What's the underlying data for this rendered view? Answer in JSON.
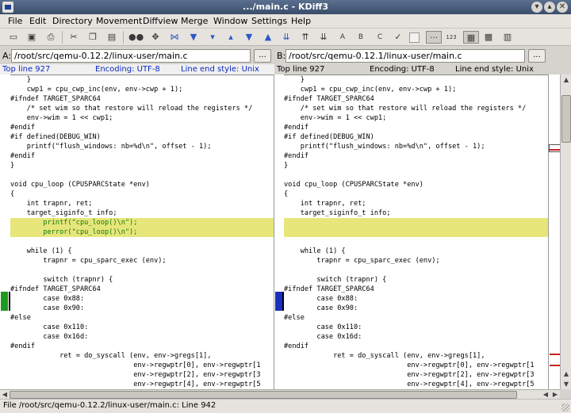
{
  "window": {
    "title": ".../main.c - KDiff3"
  },
  "menubar": [
    "File",
    "Edit",
    "Directory",
    "Movement",
    "Diffview",
    "Merge",
    "Window",
    "Settings",
    "Help"
  ],
  "toolbar": {
    "icons": [
      "open-icon",
      "save-icon",
      "print-icon",
      "cut-icon",
      "copy-icon",
      "paste-icon",
      "find-icon",
      "go-current-icon",
      "go-top-icon",
      "go-bottom-icon",
      "go-prev-delta-icon",
      "go-next-delta-icon",
      "go-prev-conflict-icon",
      "go-next-conflict-icon",
      "go-prev-unsolved-icon",
      "go-next-unsolved-icon",
      "choose-a-icon",
      "choose-b-icon",
      "choose-c-icon",
      "auto-advance-icon",
      "show-whitespace-icon",
      "show-line-numbers-icon",
      "split-diff-icon",
      "join-diffs-icon",
      "toggle-overview-icon"
    ],
    "text_buttons": {
      "choose_a": "A",
      "choose_b": "B",
      "choose_c": "C",
      "line_numbers": "123"
    }
  },
  "paneA": {
    "label": "A:",
    "path": "/root/src/qemu-0.12.2/linux-user/main.c",
    "browse": "...",
    "top_line": "Top line 927",
    "encoding": "Encoding: UTF-8",
    "line_end": "Line end style: Unix",
    "lines": [
      "    }",
      "    cwp1 = cpu_cwp_inc(env, env->cwp + 1);",
      "#ifndef TARGET_SPARC64",
      "    /* set wim so that restore will reload the registers */",
      "    env->wim = 1 << cwp1;",
      "#endif",
      "#if defined(DEBUG_WIN)",
      "    printf(\"flush_windows: nb=%d\\n\", offset - 1);",
      "#endif",
      "}",
      "",
      "void cpu_loop (CPUSPARCState *env)",
      "{",
      "    int trapnr, ret;",
      "    target_siginfo_t info;",
      "        printf(\"cpu_loop()\\n\");",
      "        perror(\"cpu_loop()\\n\");",
      "",
      "    while (1) {",
      "        trapnr = cpu_sparc_exec (env);",
      "",
      "        switch (trapnr) {",
      "#ifndef TARGET_SPARC64",
      "        case 0x88:",
      "        case 0x90:",
      "#else",
      "        case 0x110:",
      "        case 0x16d:",
      "#endif",
      "            ret = do_syscall (env, env->gregs[1],",
      "                              env->regwptr[0], env->regwptr[1",
      "                              env->regwptr[2], env->regwptr[3",
      "                              env->regwptr[4], env->regwptr[5"
    ]
  },
  "paneB": {
    "label": "B:",
    "path": "/root/src/qemu-0.12.1/linux-user/main.c",
    "browse": "...",
    "top_line": "Top line 927",
    "encoding": "Encoding: UTF-8",
    "line_end": "Line end style: Unix",
    "lines": [
      "    }",
      "    cwp1 = cpu_cwp_inc(env, env->cwp + 1);",
      "#ifndef TARGET_SPARC64",
      "    /* set wim so that restore will reload the registers */",
      "    env->wim = 1 << cwp1;",
      "#endif",
      "#if defined(DEBUG_WIN)",
      "    printf(\"flush_windows: nb=%d\\n\", offset - 1);",
      "#endif",
      "}",
      "",
      "void cpu_loop (CPUSPARCState *env)",
      "{",
      "    int trapnr, ret;",
      "    target_siginfo_t info;",
      "",
      "",
      "",
      "    while (1) {",
      "        trapnr = cpu_sparc_exec (env);",
      "",
      "        switch (trapnr) {",
      "#ifndef TARGET_SPARC64",
      "        case 0x88:",
      "        case 0x90:",
      "#else",
      "        case 0x110:",
      "        case 0x16d:",
      "#endif",
      "            ret = do_syscall (env, env->gregs[1],",
      "                              env->regwptr[0], env->regwptr[1",
      "                              env->regwptr[2], env->regwptr[3",
      "                              env->regwptr[4], env->regwptr[5"
    ]
  },
  "diff": {
    "changed_lines": [
      15,
      16
    ],
    "paneA_color": "#1f9a1f",
    "paneB_color": "#1a2fbf",
    "highlight": "#e6e67a",
    "removed_text_color": "#17790d"
  },
  "statusbar": {
    "text": "File /root/src/qemu-0.12.2/linux-user/main.c: Line 942"
  }
}
